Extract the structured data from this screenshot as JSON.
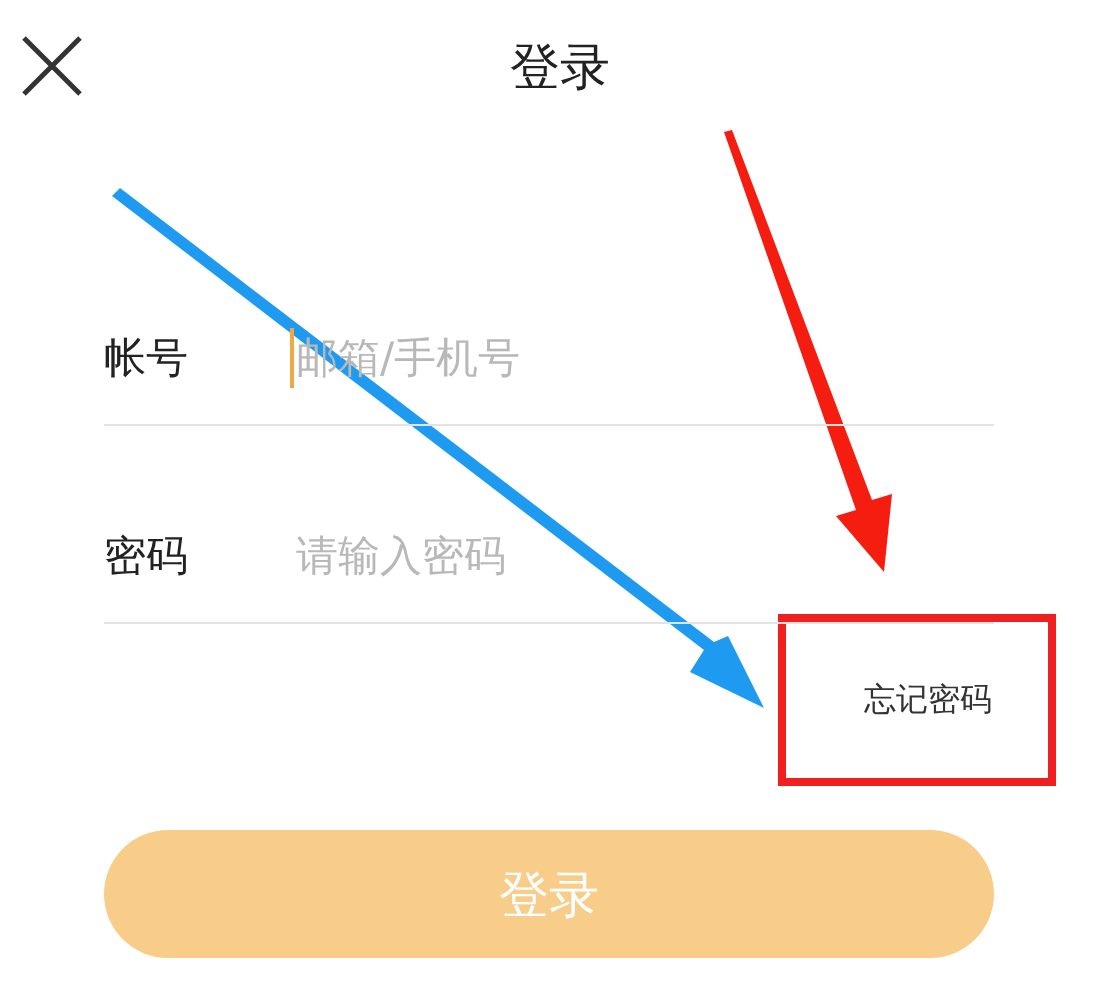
{
  "header": {
    "title": "登录"
  },
  "fields": [
    {
      "label": "帐号",
      "placeholder": "邮箱/手机号",
      "focused": true
    },
    {
      "label": "密码",
      "placeholder": "请输入密码",
      "focused": false
    }
  ],
  "forgot_link": "忘记密码",
  "submit_button": "登录"
}
